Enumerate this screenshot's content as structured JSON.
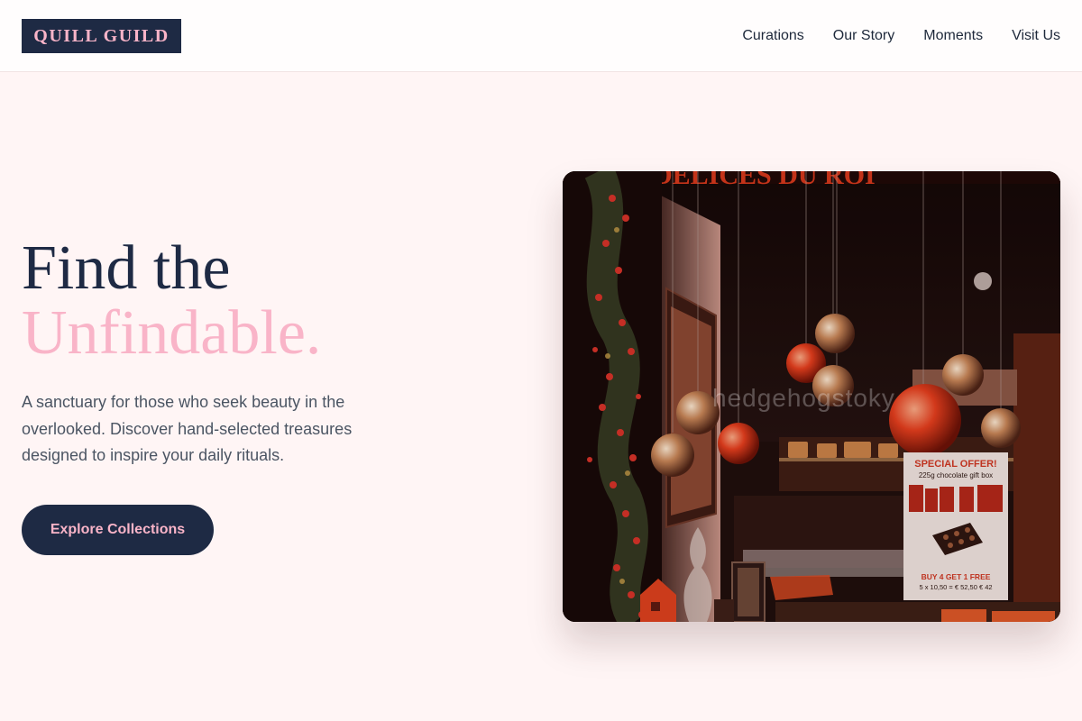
{
  "brand": {
    "logo_text": "QUILL GUILD"
  },
  "nav": {
    "items": [
      {
        "label": "Curations"
      },
      {
        "label": "Our Story"
      },
      {
        "label": "Moments"
      },
      {
        "label": "Visit Us"
      }
    ]
  },
  "hero": {
    "title_line1": "Find the",
    "title_line2": "Unfindable.",
    "subtitle": "A sanctuary for those who seek beauty in the overlooked. Discover hand-selected treasures designed to inspire your daily rituals.",
    "cta_label": "Explore Collections"
  },
  "photo": {
    "storefront_sign": "DELICES DU ROI",
    "watermark": "hedgehogstoky",
    "poster_heading": "SPECIAL OFFER!",
    "poster_product": "225g chocolate gift box",
    "poster_deal": "BUY 4 GET 1 FREE",
    "poster_price": "5 x 10,50 = € 52,50  € 42"
  },
  "colors": {
    "navy": "#1e2a44",
    "pink": "#f9b4c8",
    "background": "#fff5f5"
  }
}
